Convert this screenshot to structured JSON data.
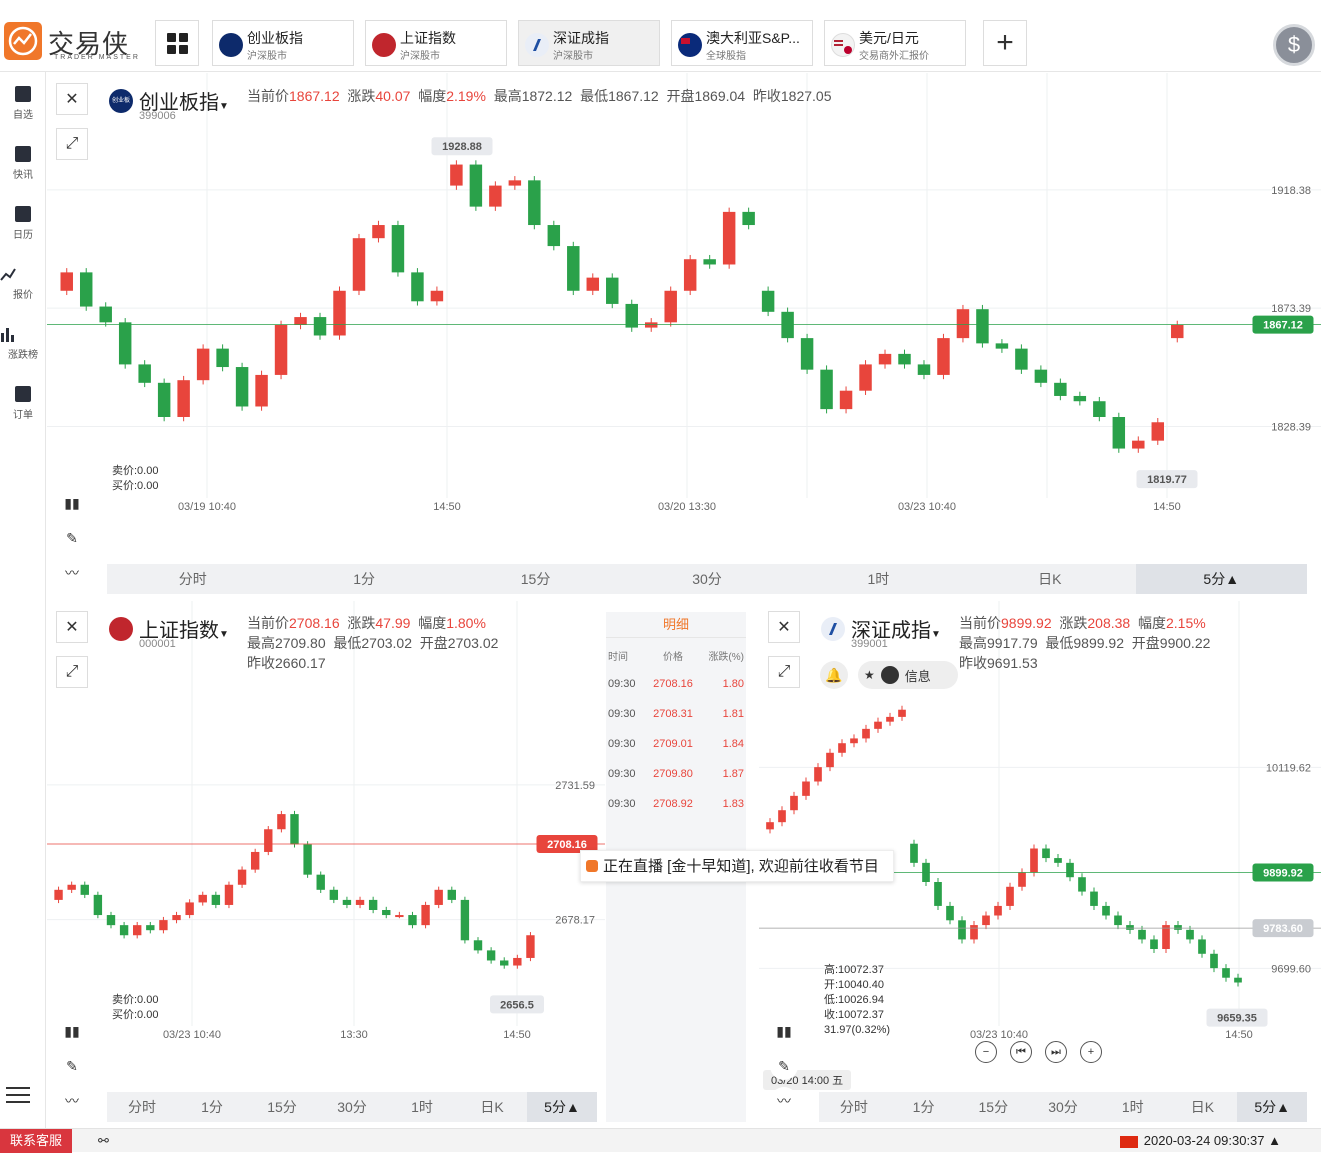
{
  "brand": {
    "name_cn": "交易侠",
    "name_en": "TRADER MASTER"
  },
  "tabs": [
    {
      "name": "创业板指",
      "sub": "沪深股市",
      "flag_color": "#0d2a6b",
      "active": false
    },
    {
      "name": "上证指数",
      "sub": "沪深股市",
      "flag_color": "#c0262d",
      "active": false
    },
    {
      "name": "深证成指",
      "sub": "沪深股市",
      "flag_color": "#ffffff",
      "active": true
    },
    {
      "name": "澳大利亚S&P...",
      "sub": "全球股指",
      "flag_color": "#0a2a7a",
      "active": false
    },
    {
      "name": "美元/日元",
      "sub": "交易商外汇报价",
      "flag_color": "#ffffff",
      "active": false
    }
  ],
  "add_tab": "+",
  "dollar": "$",
  "sidebar": [
    {
      "label": "自选",
      "icon": "bookmark-icon"
    },
    {
      "label": "快讯",
      "icon": "news-icon"
    },
    {
      "label": "日历",
      "icon": "calendar-icon"
    },
    {
      "label": "报价",
      "icon": "chart-line-icon"
    },
    {
      "label": "涨跌榜",
      "icon": "bar-chart-icon"
    },
    {
      "label": "订单",
      "icon": "clipboard-icon"
    }
  ],
  "panels": {
    "top": {
      "logo_text": "创业板",
      "name": "创业板指",
      "code": "399006",
      "stats": [
        [
          "当前价",
          "1867.12",
          "red"
        ],
        [
          "涨跌",
          "40.07",
          "red"
        ],
        [
          "幅度",
          "2.19%",
          "red"
        ],
        [
          "最高",
          "1872.12",
          ""
        ],
        [
          "最低",
          "1867.12",
          ""
        ],
        [
          "开盘",
          "1869.04",
          ""
        ],
        [
          "昨收",
          "1827.05",
          ""
        ]
      ],
      "bid": "卖价:0.00",
      "ask": "买价:0.00",
      "price_labels": [
        "1918.38",
        "1873.39",
        "1828.39"
      ],
      "current_price": "1867.12",
      "high_tag": "1928.88",
      "low_tag": "1819.77",
      "xlabels": [
        "03/19 10:40",
        "14:50",
        "03/20 13:30",
        "03/23 10:40",
        "14:50"
      ],
      "tf": [
        "分时",
        "1分",
        "15分",
        "30分",
        "1时",
        "日K",
        "5分▲"
      ],
      "tf_selected": 6
    },
    "bl": {
      "name": "上证指数",
      "code": "000001",
      "stats_line1": [
        [
          "当前价",
          "2708.16",
          "red"
        ],
        [
          "涨跌",
          "47.99",
          "red"
        ],
        [
          "幅度",
          "1.80%",
          "red"
        ]
      ],
      "stats_line2": [
        [
          "最高",
          "2709.80",
          ""
        ],
        [
          "最低",
          "2703.02",
          ""
        ],
        [
          "开盘",
          "2703.02",
          ""
        ]
      ],
      "stats_line3": [
        [
          "昨收",
          "2660.17",
          ""
        ]
      ],
      "bid": "卖价:0.00",
      "ask": "买价:0.00",
      "price_labels": [
        "2731.59",
        "2678.17"
      ],
      "current_price": "2708.16",
      "low_tag": "2656.5",
      "xlabels": [
        "03/23 10:40",
        "13:30",
        "14:50"
      ],
      "tf": [
        "分时",
        "1分",
        "15分",
        "30分",
        "1时",
        "日K",
        "5分▲"
      ],
      "tf_selected": 6
    },
    "br": {
      "name": "深证成指",
      "code": "399001",
      "stats_line1": [
        [
          "当前价",
          "9899.92",
          "red"
        ],
        [
          "涨跌",
          "208.38",
          "red"
        ],
        [
          "幅度",
          "2.15%",
          "red"
        ]
      ],
      "stats_line2": [
        [
          "最高",
          "9917.79",
          ""
        ],
        [
          "最低",
          "9899.92",
          ""
        ],
        [
          "开盘",
          "9900.22",
          ""
        ]
      ],
      "stats_line3": [
        [
          "昨收",
          "9691.53",
          ""
        ]
      ],
      "info_label": "信息",
      "price_labels": [
        "10119.62",
        "9699.60"
      ],
      "current_price": "9899.92",
      "cross_price": "9783.60",
      "low_tag": "9659.35",
      "ohlc": [
        "高:10072.37",
        "开:10040.40",
        "低:10026.94",
        "收:10072.37",
        "31.97(0.32%)"
      ],
      "cross_time": "03/20 14:00 五",
      "xlabels": [
        "03/23 10:40",
        "14:50"
      ],
      "tf": [
        "分时",
        "1分",
        "15分",
        "30分",
        "1时",
        "日K",
        "5分▲"
      ],
      "tf_selected": 6
    }
  },
  "ticks": {
    "title": "明细",
    "headers": [
      "时间",
      "价格",
      "涨跌(%)"
    ],
    "rows": [
      [
        "09:30",
        "2708.16",
        "1.80"
      ],
      [
        "09:30",
        "2708.31",
        "1.81"
      ],
      [
        "09:30",
        "2709.01",
        "1.84"
      ],
      [
        "09:30",
        "2709.80",
        "1.87"
      ],
      [
        "09:30",
        "2708.92",
        "1.83"
      ]
    ]
  },
  "live_banner": "正在直播 [金十早知道], 欢迎前往收看节目",
  "footer": {
    "service": "联系客服",
    "datetime": "2020-03-24 09:30:37 ▲"
  },
  "colors": {
    "up": "#e8453c",
    "down": "#2aa14a",
    "accent": "#f0772a"
  },
  "chart_data": [
    {
      "type": "candlestick",
      "title": "创业板指",
      "y_labels": [
        1918.38,
        1873.39,
        1828.39
      ],
      "current": 1867.12,
      "max_label": 1928.88,
      "min_label": 1819.77,
      "close_series": [
        1887,
        1874,
        1868,
        1852,
        1845,
        1832,
        1846,
        1858,
        1851,
        1836,
        1848,
        1867,
        1870,
        1863,
        1880,
        1900,
        1905,
        1887,
        1876,
        1880,
        1928,
        1912,
        1920,
        1922,
        1905,
        1897,
        1880,
        1885,
        1875,
        1866,
        1868,
        1880,
        1892,
        1890,
        1910,
        1905,
        1872,
        1862,
        1850,
        1835,
        1842,
        1852,
        1856,
        1852,
        1848,
        1862,
        1873,
        1860,
        1858,
        1850,
        1845,
        1840,
        1838,
        1832,
        1820,
        1823,
        1830,
        1867
      ],
      "open_series": [
        1880,
        1887,
        1874,
        1868,
        1852,
        1845,
        1832,
        1846,
        1858,
        1851,
        1836,
        1848,
        1867,
        1870,
        1863,
        1880,
        1900,
        1905,
        1887,
        1876,
        1920,
        1928,
        1912,
        1920,
        1922,
        1905,
        1897,
        1880,
        1885,
        1875,
        1866,
        1868,
        1880,
        1892,
        1890,
        1910,
        1880,
        1872,
        1862,
        1850,
        1835,
        1842,
        1852,
        1856,
        1852,
        1848,
        1862,
        1873,
        1860,
        1858,
        1850,
        1845,
        1840,
        1838,
        1832,
        1820,
        1823,
        1862
      ]
    },
    {
      "type": "candlestick",
      "title": "上证指数",
      "y_labels": [
        2731.59,
        2678.17
      ],
      "current": 2708.16,
      "min_label": 2656.5,
      "close_series": [
        2690,
        2692,
        2688,
        2680,
        2676,
        2672,
        2676,
        2674,
        2678,
        2680,
        2685,
        2688,
        2684,
        2692,
        2698,
        2705,
        2714,
        2720,
        2708,
        2696,
        2690,
        2686,
        2684,
        2686,
        2682,
        2680,
        2680,
        2676,
        2684,
        2690,
        2686,
        2670,
        2666,
        2662,
        2660,
        2663,
        2672
      ],
      "open_series": [
        2686,
        2690,
        2692,
        2688,
        2680,
        2676,
        2672,
        2676,
        2674,
        2678,
        2680,
        2685,
        2688,
        2684,
        2692,
        2698,
        2705,
        2714,
        2720,
        2708,
        2696,
        2690,
        2686,
        2684,
        2686,
        2682,
        2680,
        2680,
        2676,
        2684,
        2690,
        2686,
        2670,
        2666,
        2662,
        2660,
        2663
      ]
    },
    {
      "type": "candlestick",
      "title": "深证成指",
      "y_labels": [
        10119.62,
        9699.6
      ],
      "current": 9899.92,
      "crosshair": 9783.6,
      "min_label": 9659.35,
      "close_series": [
        10005,
        10030,
        10060,
        10090,
        10120,
        10150,
        10170,
        10180,
        10200,
        10215,
        10225,
        10240,
        9920,
        9880,
        9830,
        9800,
        9760,
        9790,
        9810,
        9830,
        9870,
        9900,
        9950,
        9930,
        9920,
        9890,
        9860,
        9830,
        9810,
        9790,
        9780,
        9760,
        9740,
        9790,
        9780,
        9760,
        9730,
        9700,
        9680,
        9670
      ],
      "open_series": [
        9990,
        10005,
        10030,
        10060,
        10090,
        10120,
        10150,
        10170,
        10180,
        10200,
        10215,
        10225,
        9960,
        9920,
        9880,
        9830,
        9800,
        9760,
        9790,
        9810,
        9830,
        9870,
        9900,
        9950,
        9930,
        9920,
        9890,
        9860,
        9830,
        9810,
        9790,
        9780,
        9760,
        9740,
        9790,
        9780,
        9760,
        9730,
        9700,
        9680
      ]
    }
  ]
}
